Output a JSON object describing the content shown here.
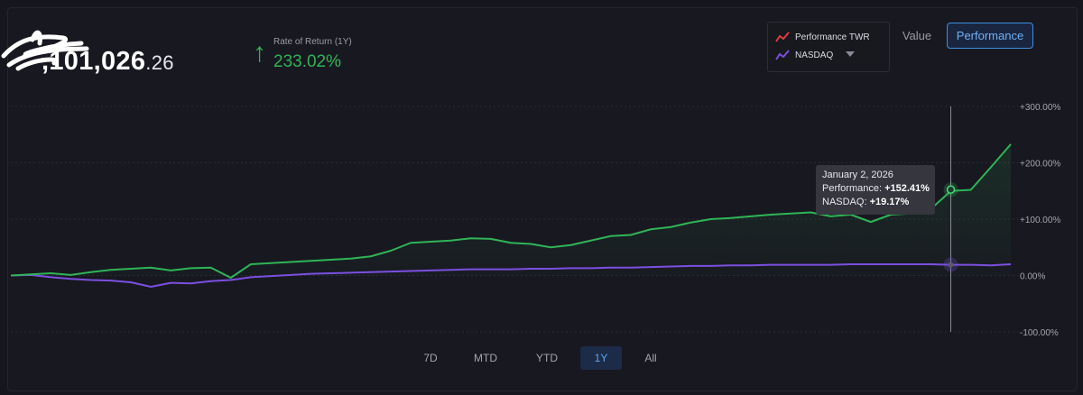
{
  "portfolio": {
    "balance_main": ",101,026",
    "balance_cents": ".26"
  },
  "rate_of_return": {
    "label": "Rate of Return (1Y)",
    "value": "233.02%",
    "arrow": "up-arrow-icon",
    "color": "#2fb457"
  },
  "legend": {
    "items": [
      {
        "label": "Performance TWR",
        "icon": "line-chart-icon",
        "color": "#e03a3e"
      },
      {
        "label": "NASDAQ",
        "icon": "line-chart-icon",
        "color": "#7b4fe0"
      }
    ]
  },
  "view_toggle": {
    "value_label": "Value",
    "performance_label": "Performance",
    "selected": "Performance"
  },
  "tooltip": {
    "date": "January 2, 2026",
    "perf_label": "Performance: ",
    "perf_value": "+152.41%",
    "nasdaq_label": "NASDAQ: ",
    "nasdaq_value": "+19.17%"
  },
  "range_tabs": {
    "items": [
      "7D",
      "MTD",
      "YTD",
      "1Y",
      "All"
    ],
    "selected": "1Y"
  },
  "chart_data": {
    "type": "line",
    "ylim": [
      -100,
      300
    ],
    "y_ticks": [
      300,
      200,
      100,
      0,
      -100
    ],
    "y_tick_labels": [
      "+300.00%",
      "+200.00%",
      "+100.00%",
      "0.00%",
      "-100.00%"
    ],
    "grid": true,
    "colors": {
      "performance": "#2fb457",
      "nasdaq": "#7b4fe0"
    },
    "x": [
      0,
      2,
      4,
      6,
      8,
      10,
      12,
      14,
      16,
      18,
      20,
      22,
      24,
      26,
      28,
      30,
      32,
      34,
      36,
      38,
      40,
      42,
      44,
      46,
      48,
      50,
      52,
      54,
      56,
      58,
      60,
      62,
      64,
      66,
      68,
      70,
      72,
      74,
      76,
      78,
      80,
      82,
      84,
      86,
      88,
      90,
      92,
      94,
      96,
      98,
      100
    ],
    "series": [
      {
        "name": "Performance TWR",
        "values": [
          0,
          2,
          4,
          1,
          6,
          10,
          12,
          14,
          9,
          13,
          14,
          -4,
          20,
          22,
          24,
          26,
          28,
          30,
          34,
          44,
          58,
          60,
          62,
          66,
          65,
          58,
          56,
          50,
          54,
          62,
          70,
          72,
          82,
          86,
          94,
          100,
          102,
          105,
          108,
          110,
          112,
          105,
          108,
          95,
          108,
          110,
          118,
          150,
          152,
          192,
          233
        ]
      },
      {
        "name": "NASDAQ",
        "values": [
          0,
          1,
          -3,
          -6,
          -8,
          -9,
          -12,
          -20,
          -13,
          -14,
          -10,
          -8,
          -3,
          -1,
          1,
          3,
          4,
          5,
          6,
          7,
          8,
          9,
          10,
          11,
          11,
          11,
          12,
          12,
          13,
          13,
          14,
          14,
          15,
          16,
          17,
          17,
          18,
          18,
          19,
          19,
          19,
          19,
          20,
          20,
          20,
          20,
          20,
          19,
          19,
          18,
          20
        ]
      }
    ],
    "hover_index": 47,
    "tooltip": {
      "date": "January 2, 2026",
      "performance": 152.41,
      "nasdaq": 19.17
    }
  }
}
